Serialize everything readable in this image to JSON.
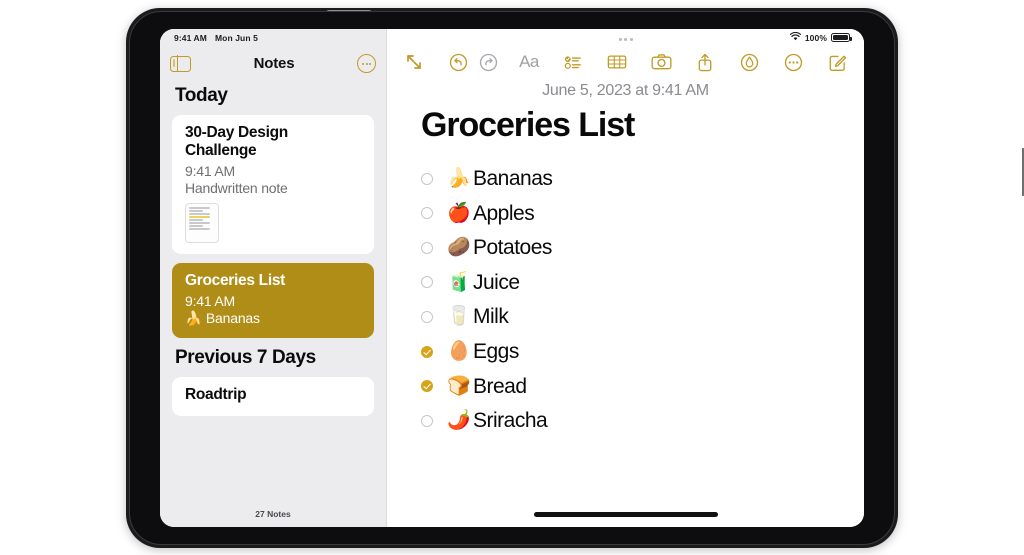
{
  "status_bar": {
    "time": "9:41 AM",
    "date": "Mon Jun 5",
    "wifi_icon": "wifi-icon",
    "battery_percent": "100%",
    "battery_icon": "battery-full-icon"
  },
  "sidebar": {
    "title": "Notes",
    "toggle_icon": "sidebar-toggle-icon",
    "more_icon": "more-circle-icon",
    "groups": [
      {
        "title": "Today",
        "notes": [
          {
            "title": "30-Day Design Challenge",
            "time": "9:41 AM",
            "snippet": "Handwritten note",
            "has_thumbnail": true,
            "selected": false
          },
          {
            "title": "Groceries List",
            "time": "9:41 AM",
            "snippet": "🍌 Bananas",
            "has_thumbnail": false,
            "selected": true
          }
        ]
      },
      {
        "title": "Previous 7 Days",
        "notes": [
          {
            "title": "Roadtrip",
            "time": "",
            "snippet": "",
            "has_thumbnail": false,
            "selected": false
          }
        ]
      }
    ],
    "footer": "27 Notes"
  },
  "toolbar": {
    "expand_icon": "expand-arrows-icon",
    "undo_icon": "undo-icon",
    "redo_icon": "redo-icon",
    "format_label": "Aa",
    "checklist_icon": "checklist-icon",
    "table_icon": "table-icon",
    "camera_icon": "camera-icon",
    "share_icon": "share-icon",
    "markup_icon": "markup-pen-icon",
    "more_icon": "more-circle-icon",
    "compose_icon": "compose-icon"
  },
  "note": {
    "date": "June 5, 2023 at 9:41 AM",
    "title": "Groceries List",
    "items": [
      {
        "emoji": "🍌",
        "label": "Bananas",
        "checked": false
      },
      {
        "emoji": "🍎",
        "label": "Apples",
        "checked": false
      },
      {
        "emoji": "🥔",
        "label": "Potatoes",
        "checked": false
      },
      {
        "emoji": "🧃",
        "label": "Juice",
        "checked": false
      },
      {
        "emoji": "🥛",
        "label": "Milk",
        "checked": false
      },
      {
        "emoji": "🥚",
        "label": "Eggs",
        "checked": true
      },
      {
        "emoji": "🍞",
        "label": "Bread",
        "checked": true
      },
      {
        "emoji": "🌶️",
        "label": "Sriracha",
        "checked": false
      }
    ]
  },
  "colors": {
    "accent_gold": "#c09b26",
    "selected_card": "#b08d17",
    "checked_circle": "#d5a419",
    "sidebar_bg": "#ececef"
  }
}
